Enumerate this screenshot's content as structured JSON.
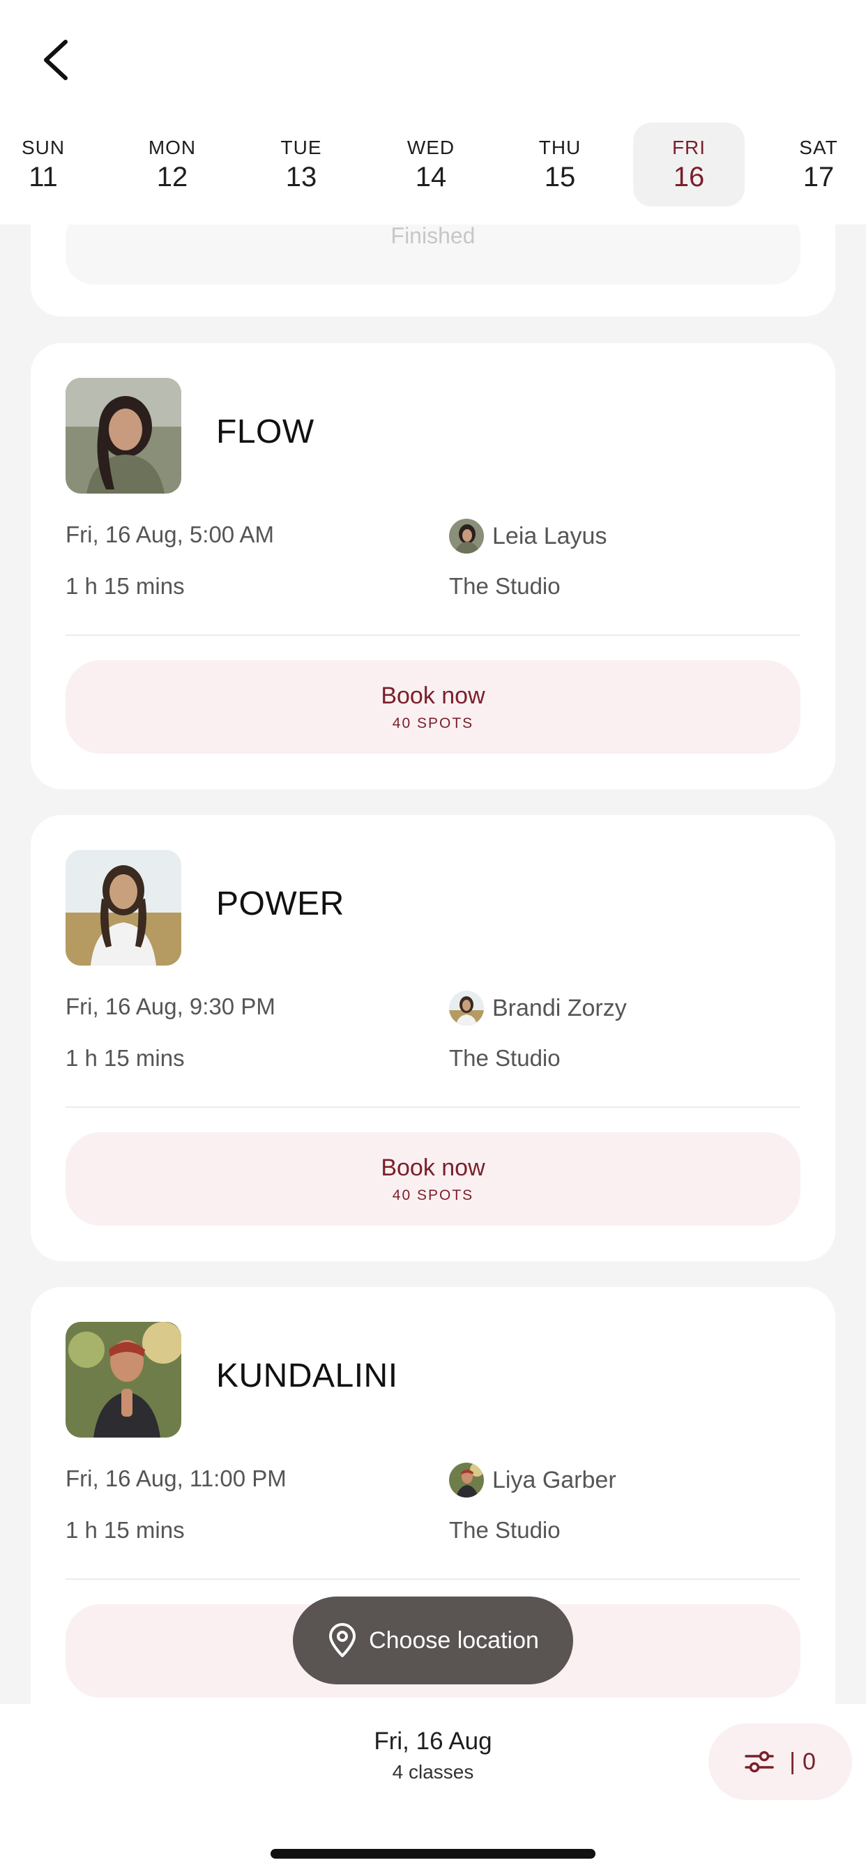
{
  "header": {
    "days": [
      {
        "name": "SUN",
        "date": "11"
      },
      {
        "name": "MON",
        "date": "12"
      },
      {
        "name": "TUE",
        "date": "13"
      },
      {
        "name": "WED",
        "date": "14"
      },
      {
        "name": "THU",
        "date": "15"
      },
      {
        "name": "FRI",
        "date": "16",
        "selected": true
      },
      {
        "name": "SAT",
        "date": "17"
      }
    ]
  },
  "previous_card": {
    "status": "Finished"
  },
  "classes": [
    {
      "title": "FLOW",
      "datetime": "Fri, 16 Aug, 5:00 AM",
      "duration": "1 h 15 mins",
      "instructor": "Leia Layus",
      "location": "The Studio",
      "book_label": "Book now",
      "spots": "40 SPOTS"
    },
    {
      "title": "POWER",
      "datetime": "Fri, 16 Aug, 9:30 PM",
      "duration": "1 h 15 mins",
      "instructor": "Brandi Zorzy",
      "location": "The Studio",
      "book_label": "Book now",
      "spots": "40 SPOTS"
    },
    {
      "title": "KUNDALINI",
      "datetime": "Fri, 16 Aug, 11:00 PM",
      "duration": "1 h 15 mins",
      "instructor": "Liya Garber",
      "location": "The Studio",
      "book_label": "",
      "spots": ""
    }
  ],
  "location_button": {
    "label": "Choose location",
    "icon": "map-pin-icon"
  },
  "footer": {
    "date": "Fri, 16 Aug",
    "count": "4 classes",
    "filter_separator": "|",
    "filter_count": "0",
    "filter_icon": "sliders-icon"
  },
  "colors": {
    "accent": "#7a1f2b",
    "button_bg": "#faf0f1",
    "page_bg": "#f4f4f5"
  }
}
